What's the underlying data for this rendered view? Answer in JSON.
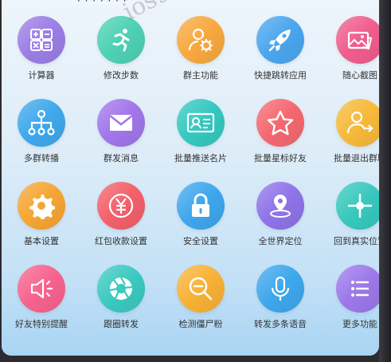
{
  "top_partial_text": "· · · · · · ·",
  "watermark": "ios98.cn",
  "items": [
    {
      "label": "计算器",
      "icon": "calculator-icon",
      "color": "#9b7ee6"
    },
    {
      "label": "修改步数",
      "icon": "running-person-icon",
      "color": "#4ed1b5"
    },
    {
      "label": "群主功能",
      "icon": "user-gear-icon",
      "color": "#f7a940"
    },
    {
      "label": "快捷跳转应用",
      "icon": "rocket-icon",
      "color": "#4aa6ee"
    },
    {
      "label": "随心截图",
      "icon": "picture-icon",
      "color": "#f05d8d"
    },
    {
      "label": "多群转播",
      "icon": "hierarchy-icon",
      "color": "#3fa8ec"
    },
    {
      "label": "群发消息",
      "icon": "envelope-icon",
      "color": "#a176ea"
    },
    {
      "label": "批量推送名片",
      "icon": "id-card-icon",
      "color": "#34c8c0"
    },
    {
      "label": "批量星标好友",
      "icon": "star-icon",
      "color": "#f46870"
    },
    {
      "label": "批量退出群聊",
      "icon": "user-exit-icon",
      "color": "#f7b93a"
    },
    {
      "label": "基本设置",
      "icon": "gear-icon",
      "color": "#f6a533"
    },
    {
      "label": "红包收款设置",
      "icon": "yen-icon",
      "color": "#f3606a"
    },
    {
      "label": "安全设置",
      "icon": "lock-icon",
      "color": "#3fa6ec"
    },
    {
      "label": "全世界定位",
      "icon": "location-pin-icon",
      "color": "#8f73e8"
    },
    {
      "label": "回到真实位置",
      "icon": "crosshair-icon",
      "color": "#38c8bd"
    },
    {
      "label": "好友特别提醒",
      "icon": "speaker-icon",
      "color": "#f6638e"
    },
    {
      "label": "跟圈转发",
      "icon": "aperture-icon",
      "color": "#3bc9c0"
    },
    {
      "label": "检测僵尸粉",
      "icon": "search-minus-icon",
      "color": "#f7b236"
    },
    {
      "label": "转发多条语音",
      "icon": "microphone-icon",
      "color": "#3ea7ec"
    },
    {
      "label": "更多功能",
      "icon": "list-icon",
      "color": "#9c78e9"
    }
  ]
}
